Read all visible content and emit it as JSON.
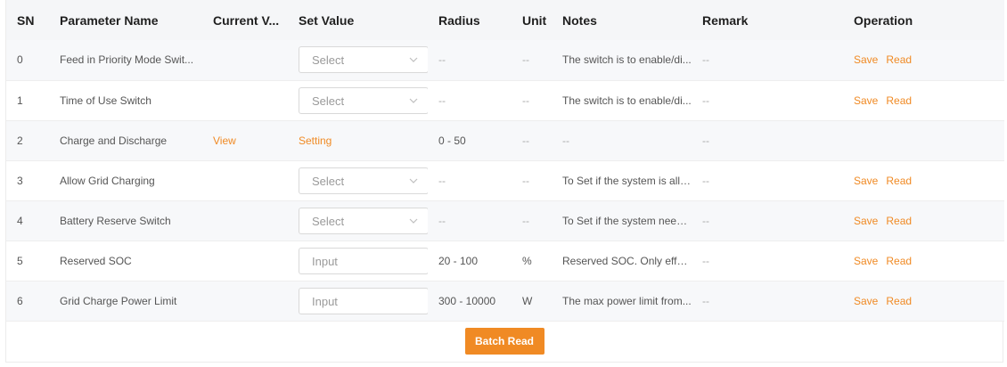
{
  "columns": [
    "SN",
    "Parameter Name",
    "Current V...",
    "Set Value",
    "Radius",
    "Unit",
    "Notes",
    "Remark",
    "Operation"
  ],
  "rows": [
    {
      "sn": "0",
      "name": "Feed in Priority Mode Swit...",
      "current": "",
      "set_type": "select",
      "set_placeholder": "Select",
      "radius": "--",
      "unit": "--",
      "notes": "The switch is to enable/di...",
      "remark": "--",
      "save": "Save",
      "read": "Read"
    },
    {
      "sn": "1",
      "name": "Time of Use Switch",
      "current": "",
      "set_type": "select",
      "set_placeholder": "Select",
      "radius": "--",
      "unit": "--",
      "notes": "The switch is to enable/di...",
      "remark": "--",
      "save": "Save",
      "read": "Read"
    },
    {
      "sn": "2",
      "name": "Charge and Discharge",
      "current": "View",
      "set_type": "link",
      "set_placeholder": "Setting",
      "radius": "0 - 50",
      "unit": "--",
      "notes": "--",
      "remark": "--",
      "save": "",
      "read": ""
    },
    {
      "sn": "3",
      "name": "Allow Grid Charging",
      "current": "",
      "set_type": "select",
      "set_placeholder": "Select",
      "radius": "--",
      "unit": "--",
      "notes": "To Set if the system is allo...",
      "remark": "--",
      "save": "Save",
      "read": "Read"
    },
    {
      "sn": "4",
      "name": "Battery Reserve Switch",
      "current": "",
      "set_type": "select",
      "set_placeholder": "Select",
      "radius": "--",
      "unit": "--",
      "notes": "To Set if the system needs...",
      "remark": "--",
      "save": "Save",
      "read": "Read"
    },
    {
      "sn": "5",
      "name": "Reserved SOC",
      "current": "",
      "set_type": "input",
      "set_placeholder": "Input",
      "radius": "20 - 100",
      "unit": "%",
      "notes": "Reserved SOC. Only effect...",
      "remark": "--",
      "save": "Save",
      "read": "Read"
    },
    {
      "sn": "6",
      "name": "Grid Charge Power Limit",
      "current": "",
      "set_type": "input",
      "set_placeholder": "Input",
      "radius": "300 - 10000",
      "unit": "W",
      "notes": "The max power limit from...",
      "remark": "--",
      "save": "Save",
      "read": "Read"
    }
  ],
  "batch_read_label": "Batch Read",
  "colors": {
    "accent": "#f08a24",
    "header_bg": "#f5f6f8",
    "stripe_bg": "#f7f8fa"
  }
}
